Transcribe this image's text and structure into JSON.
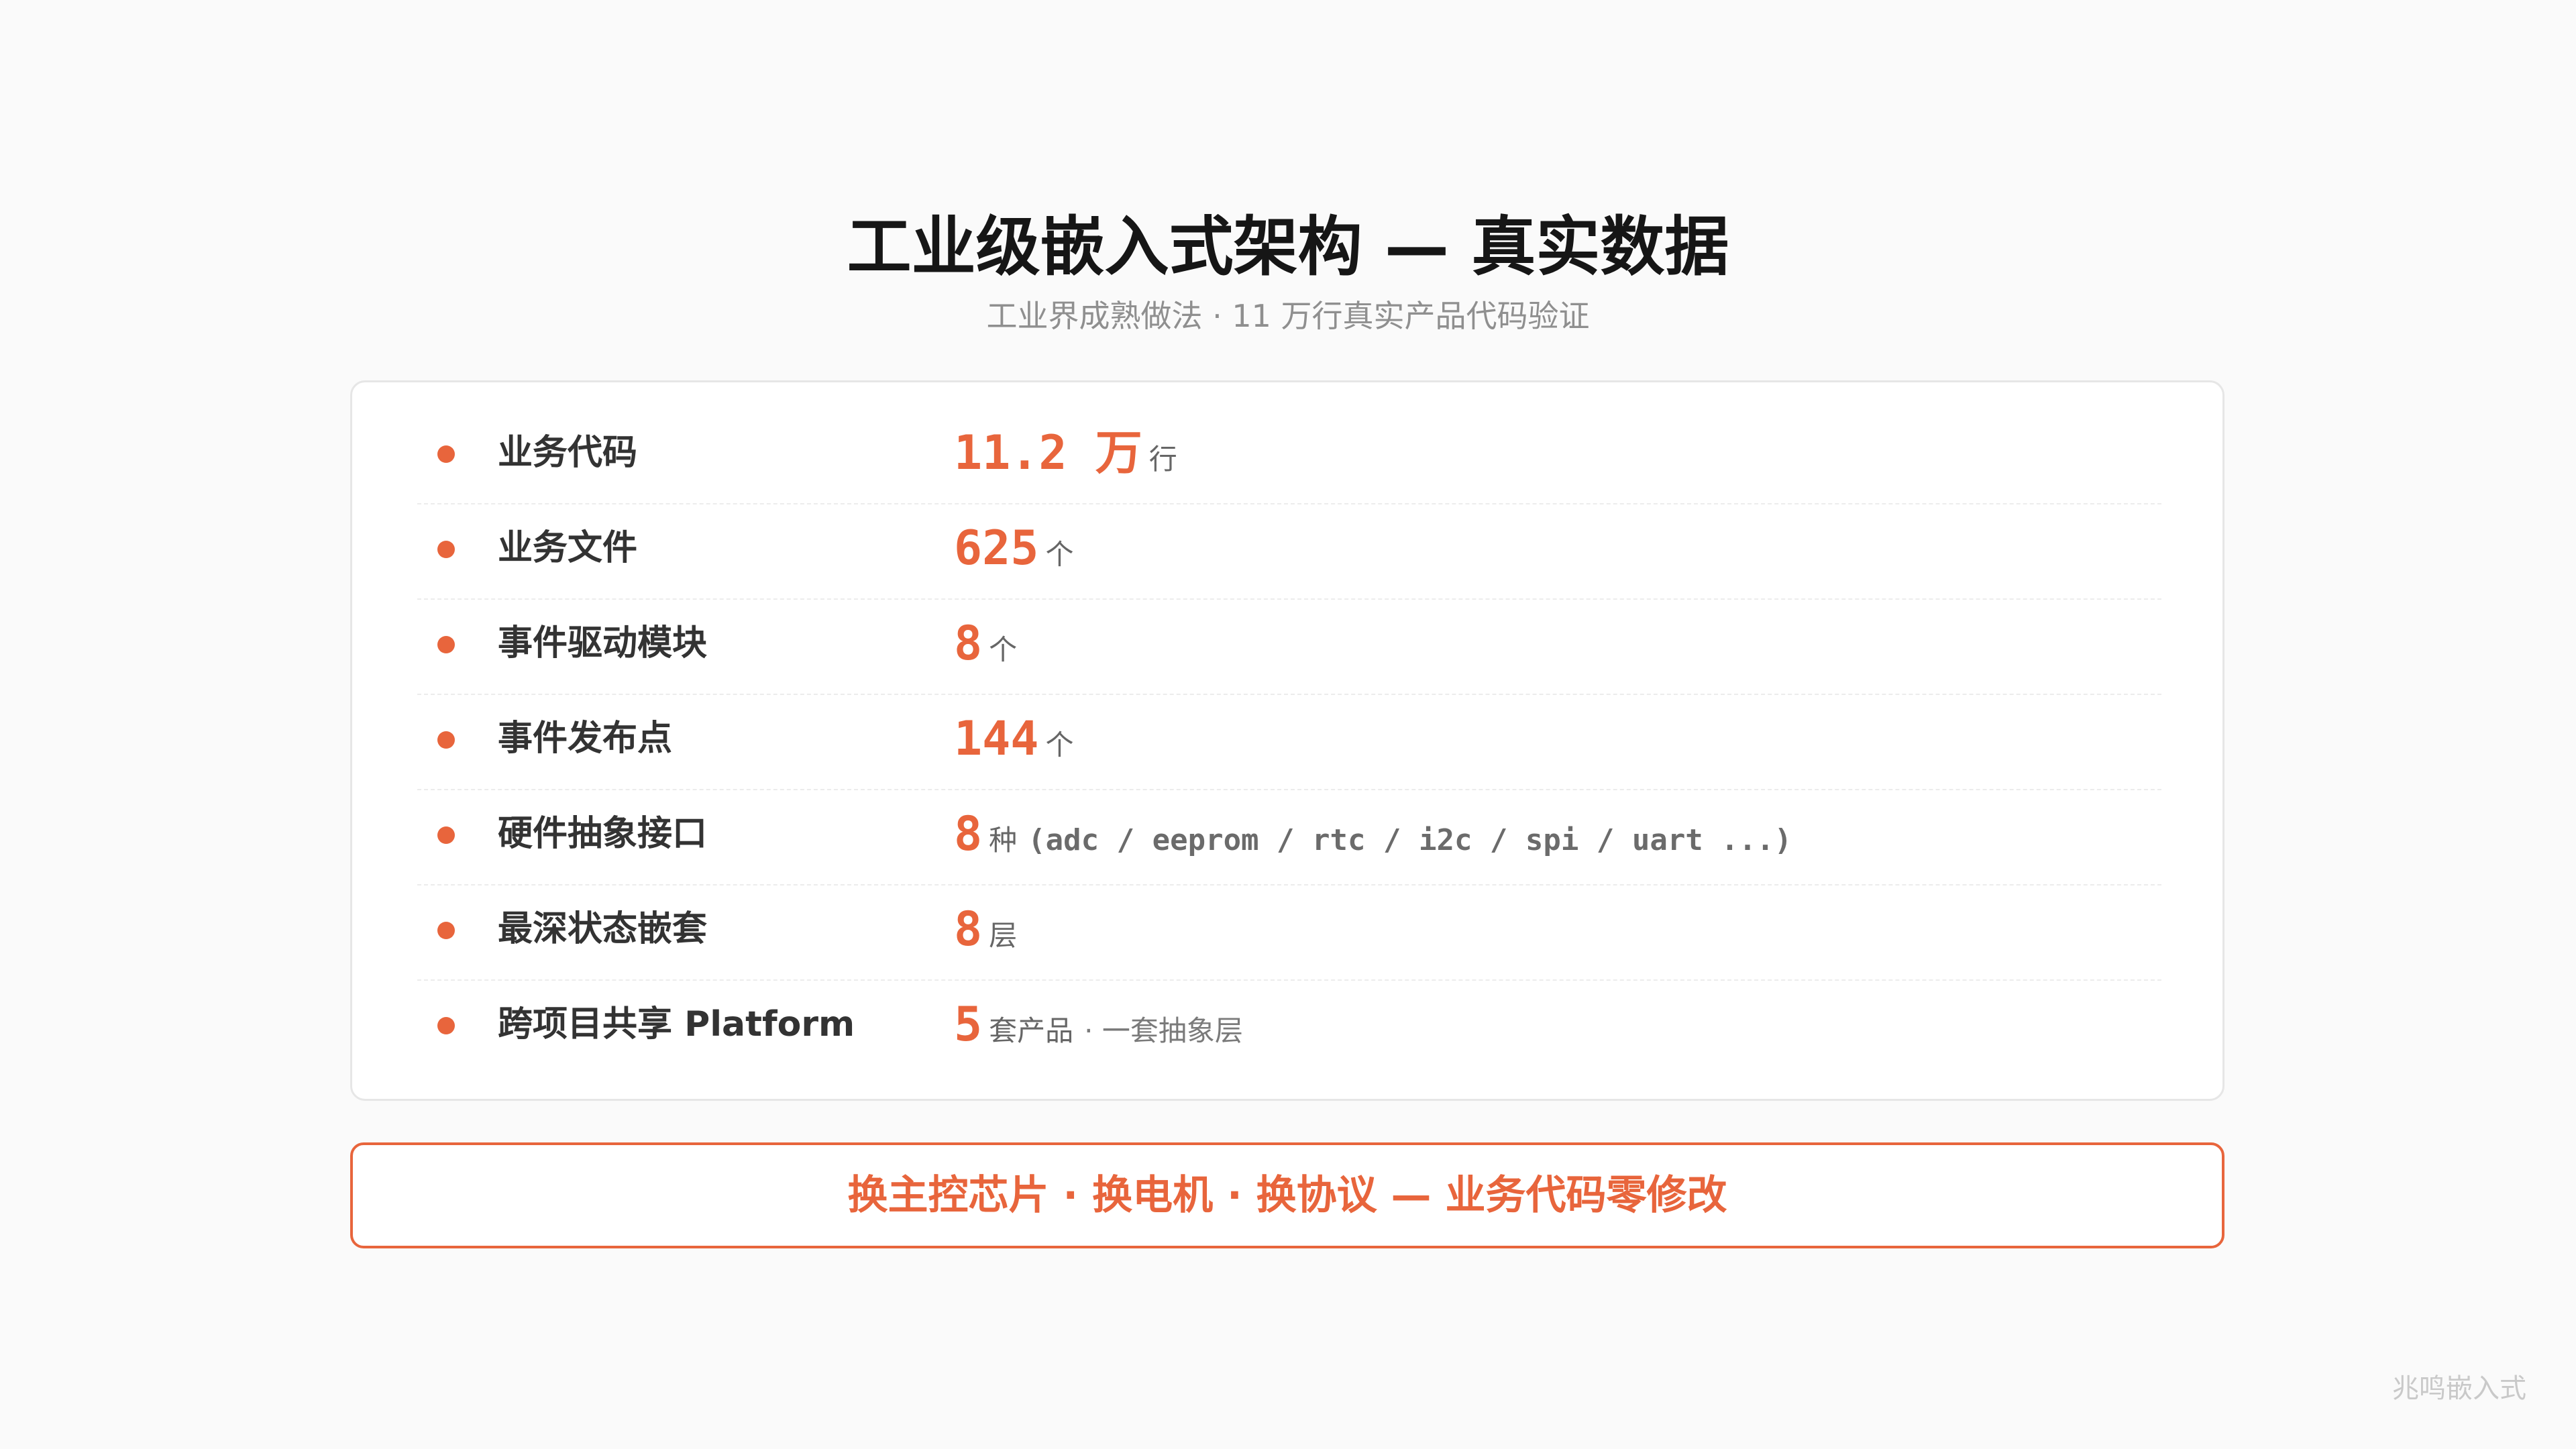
{
  "title": "工业级嵌入式架构 — 真实数据",
  "subtitle": "工业界成熟做法 · 11 万行真实产品代码验证",
  "rows": [
    {
      "label": "业务代码",
      "value": "11.2 万",
      "unit": "行",
      "extra": ""
    },
    {
      "label": "业务文件",
      "value": "625",
      "unit": "个",
      "extra": ""
    },
    {
      "label": "事件驱动模块",
      "value": "8",
      "unit": "个",
      "extra": ""
    },
    {
      "label": "事件发布点",
      "value": "144",
      "unit": "个",
      "extra": ""
    },
    {
      "label": "硬件抽象接口",
      "value": "8",
      "unit": "种",
      "extra": "(adc / eeprom / rtc / i2c / spi / uart ...)"
    },
    {
      "label": "最深状态嵌套",
      "value": "8",
      "unit": "层",
      "extra": ""
    },
    {
      "label": "跨项目共享 Platform",
      "value": "5",
      "unit": "套产品",
      "extra": "· 一套抽象层"
    }
  ],
  "banner": "换主控芯片 · 换电机 · 换协议 — 业务代码零修改",
  "watermark": "兆鸣嵌入式",
  "colors": {
    "accent": "#e8653c",
    "background": "#fafafa",
    "card": "#ffffff"
  }
}
